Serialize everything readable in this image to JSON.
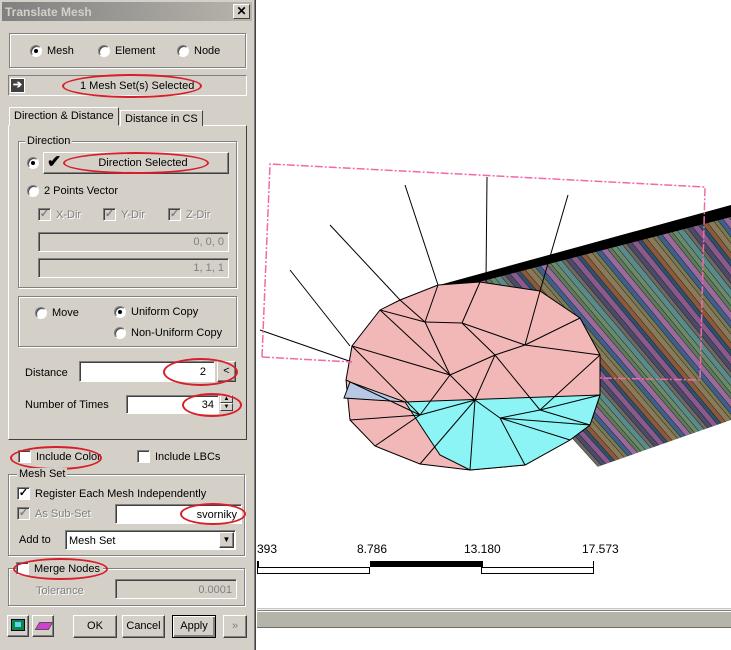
{
  "dialog": {
    "title": "Translate Mesh",
    "close_label": "✕",
    "select_mode": {
      "options": [
        {
          "label": "Mesh",
          "selected": true
        },
        {
          "label": "Element",
          "selected": false
        },
        {
          "label": "Node",
          "selected": false
        }
      ]
    },
    "selection_status": "1 Mesh Set(s) Selected",
    "tabs": [
      {
        "label": "Direction & Distance",
        "active": true
      },
      {
        "label": "Distance in CS",
        "active": false
      }
    ],
    "direction": {
      "group_label": "Direction",
      "direction_button_label": "Direction Selected",
      "direction_option_selected": true,
      "two_points_label": "2 Points Vector",
      "two_points_selected": false,
      "axes": [
        {
          "label": "X-Dir",
          "checked": true
        },
        {
          "label": "Y-Dir",
          "checked": true
        },
        {
          "label": "Z-Dir",
          "checked": true
        }
      ],
      "point1": "0, 0, 0",
      "point2": "1, 1, 1"
    },
    "operation": {
      "options": [
        {
          "label": "Move",
          "selected": false
        },
        {
          "label": "Uniform Copy",
          "selected": true
        },
        {
          "label": "Non-Uniform Copy",
          "selected": false
        }
      ]
    },
    "distance": {
      "label": "Distance",
      "value": "2",
      "pick_label": "<"
    },
    "times": {
      "label": "Number of Times",
      "value": "34"
    },
    "include_color": {
      "label": "Include Color",
      "checked": false
    },
    "include_lbcs": {
      "label": "Include LBCs",
      "checked": false
    },
    "mesh_set": {
      "group_label": "Mesh Set",
      "register_label": "Register Each Mesh Independently",
      "register_checked": true,
      "subset_label": "As Sub-Set",
      "subset_checked": true,
      "subset_name": "svorniky",
      "add_to_label": "Add to",
      "add_to_value": "Mesh Set"
    },
    "merge": {
      "label": "Merge Nodes",
      "checked": false,
      "tolerance_label": "Tolerance",
      "tolerance_value": "0.0001"
    },
    "buttons": {
      "ok": "OK",
      "cancel": "Cancel",
      "apply": "Apply",
      "more": "»"
    },
    "annotation_color": "#d81e2a"
  },
  "viewport": {
    "scale_bar": {
      "labels": [
        "393",
        "8.786",
        "13.180",
        "17.573"
      ]
    },
    "selection_box_color": "#f06aa8",
    "face_colors": {
      "primary": "#f2b8b8",
      "highlight": "#8cf4f4",
      "secondary": "#b8c8e4"
    }
  }
}
